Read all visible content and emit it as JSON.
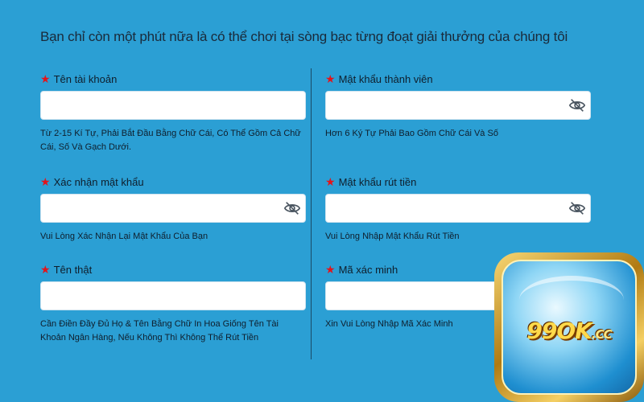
{
  "headline": "Bạn chỉ còn một phút nữa là có thể chơi tại sòng bạc từng đoạt giải thưởng của chúng tôi",
  "required_marker": "★",
  "fields": {
    "username": {
      "label": "Tên tài khoản",
      "value": "",
      "hint": "Từ 2-15 Kí Tự, Phải Bắt Đầu Bằng Chữ Cái, Có Thể Gồm Cả Chữ Cái, Số Và Gạch Dưới."
    },
    "member_password": {
      "label": "Mật khẩu thành viên",
      "value": "",
      "hint": "Hơn 6 Ký Tự Phải Bao Gồm Chữ Cái Và Số",
      "icon": "eye-off-icon"
    },
    "confirm_password": {
      "label": "Xác nhận mật khẩu",
      "value": "",
      "hint": "Vui Lòng Xác Nhận Lại Mật Khẩu Của Bạn",
      "icon": "eye-off-icon"
    },
    "withdraw_password": {
      "label": "Mật khẩu rút tiền",
      "value": "",
      "hint": "Vui Lòng Nhập Mật Khẩu Rút Tiền",
      "icon": "eye-off-icon"
    },
    "real_name": {
      "label": "Tên thật",
      "value": "",
      "hint": "Cần Điền Đầy Đủ Họ & Tên Bằng Chữ In Hoa Giống Tên Tài Khoản Ngân Hàng, Nếu Không Thì Không Thể Rút Tiền"
    },
    "verification_code": {
      "label": "Mã xác minh",
      "value": "",
      "hint": "Xin Vui Lòng Nhập Mã Xác Minh"
    }
  },
  "logo": {
    "brand": "99OK",
    "tld": ".CC"
  },
  "colors": {
    "background": "#2b9fd4",
    "required_star": "#e3141b",
    "input_bg": "#ffffff",
    "logo_gold": "#f4cf63",
    "logo_blue": "#1f8fd0"
  }
}
